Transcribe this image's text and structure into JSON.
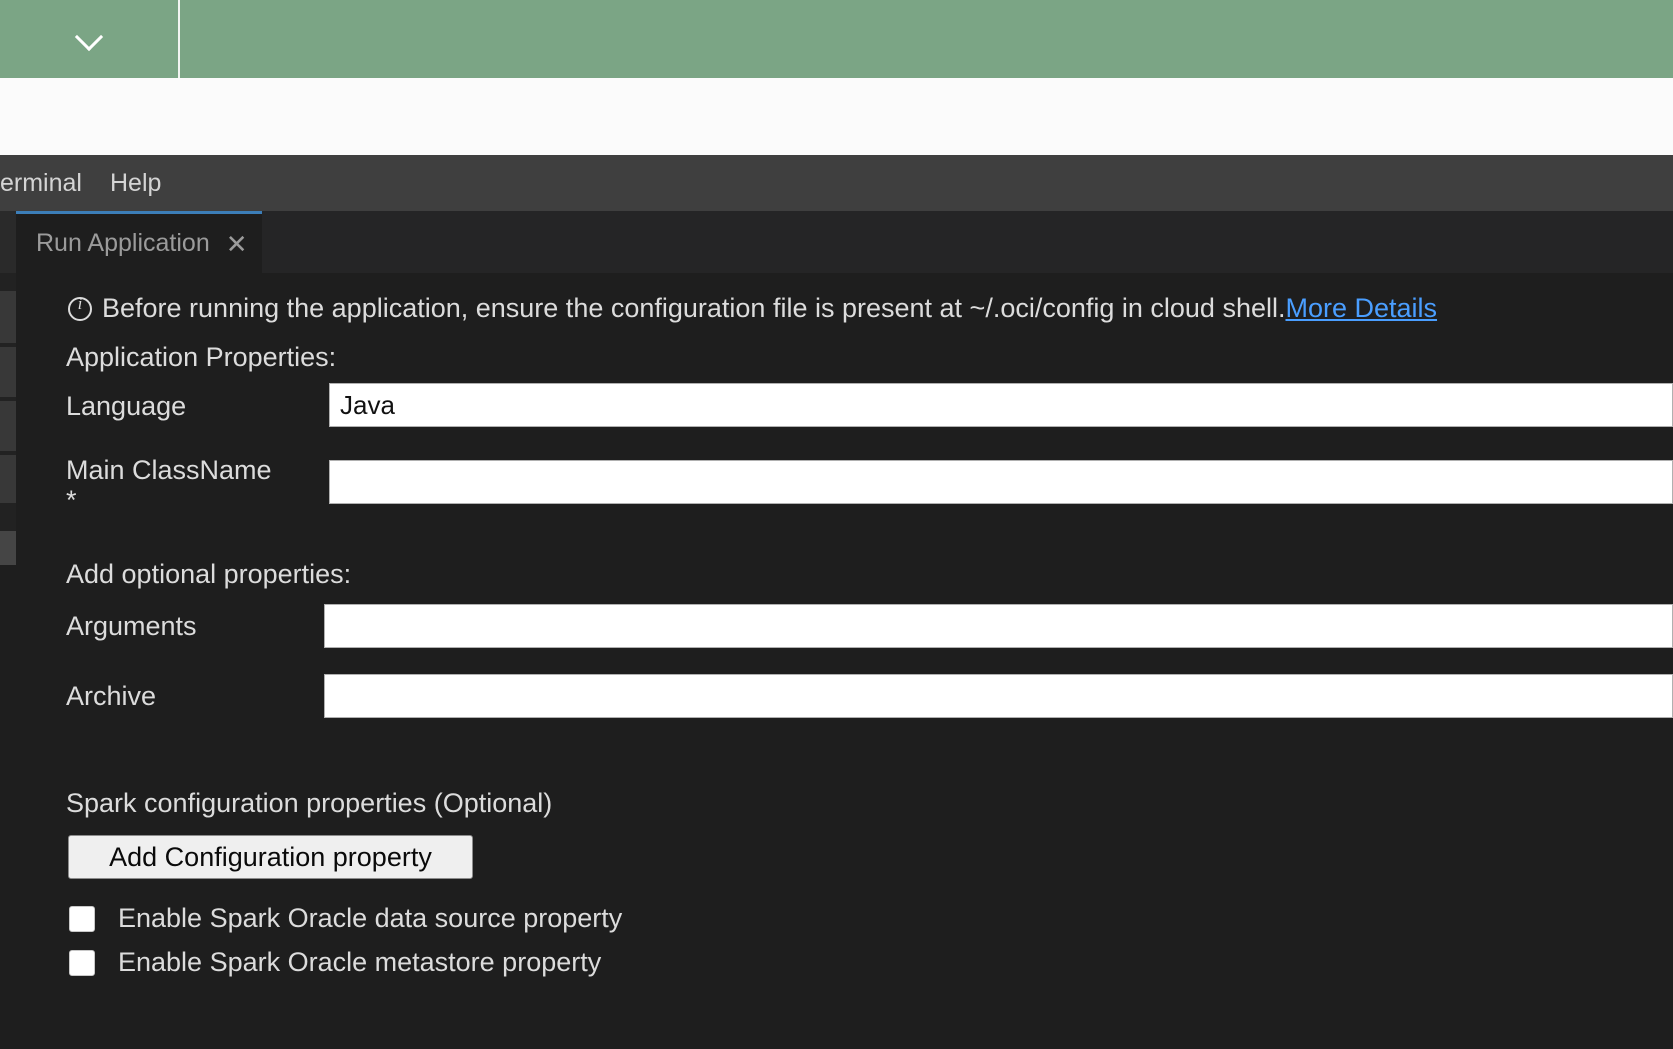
{
  "topbar": {
    "dropdown_icon": "chevron-down-icon"
  },
  "menubar": {
    "items": [
      {
        "label": "erminal"
      },
      {
        "label": "Help"
      }
    ]
  },
  "tabs": [
    {
      "label": "Run Application",
      "close_icon": "close-icon",
      "active": true
    }
  ],
  "panel": {
    "info": {
      "icon": "info-circle-icon",
      "text": "Before running the application, ensure the configuration file is present at ~/.oci/config in cloud shell.",
      "link_text": " More Details"
    },
    "application_properties_title": "Application Properties:",
    "fields": [
      {
        "label": "Language",
        "value": "Java",
        "placeholder": "",
        "required": false
      },
      {
        "label": "Main ClassName",
        "value": "",
        "placeholder": "",
        "required": true,
        "required_marker": "*"
      }
    ],
    "optional_title": "Add optional properties:",
    "optional_fields": [
      {
        "label": "Arguments",
        "value": "",
        "placeholder": ""
      },
      {
        "label": "Archive",
        "value": "",
        "placeholder": ""
      }
    ],
    "spark_title": "Spark configuration properties (Optional)",
    "add_config_button": "Add Configuration property",
    "checkboxes": [
      {
        "label": "Enable Spark Oracle data source property",
        "checked": false
      },
      {
        "label": "Enable Spark Oracle metastore property",
        "checked": false
      }
    ]
  },
  "colors": {
    "header_green": "#7ba585",
    "menubar": "#3f3f3f",
    "panel_bg": "#1e1e1e",
    "tab_accent": "#3c7eb8",
    "link": "#4a9eff"
  }
}
